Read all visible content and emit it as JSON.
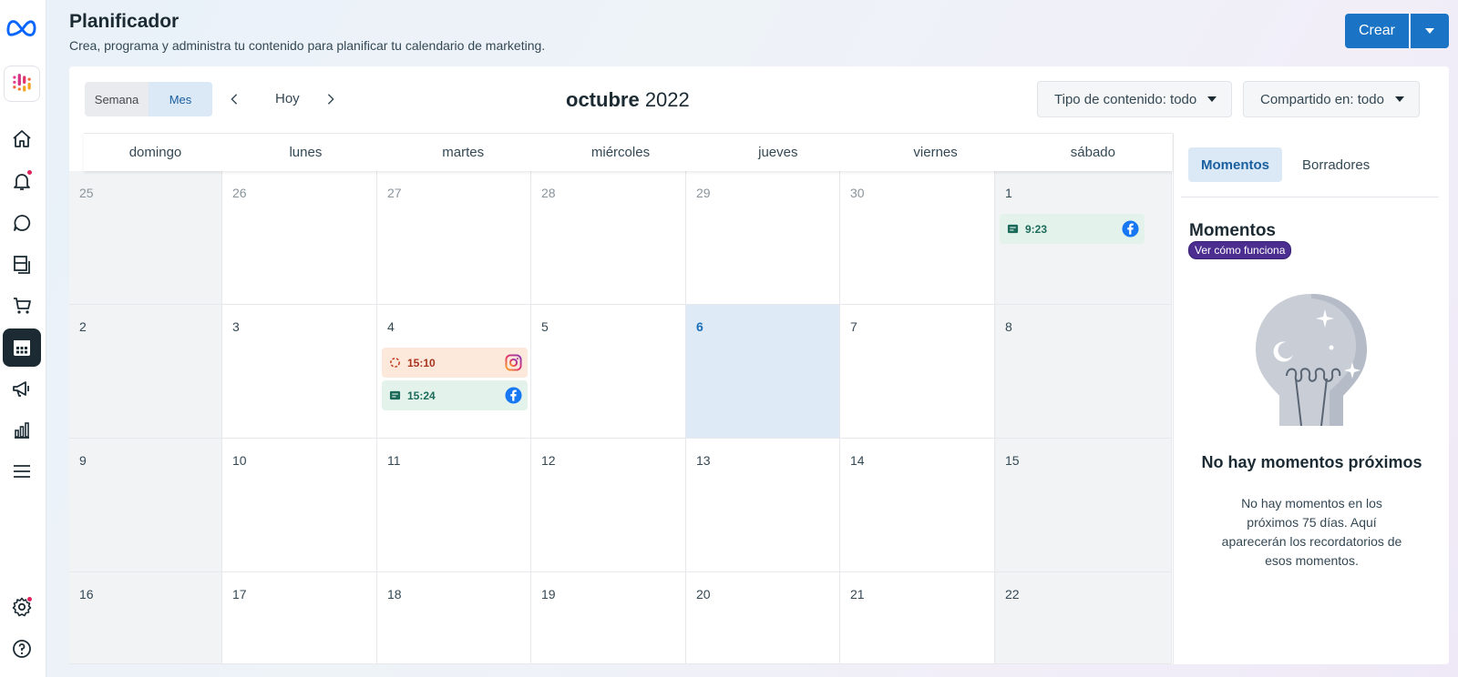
{
  "header": {
    "title": "Planificador",
    "subtitle": "Crea, programa y administra tu contenido para planificar tu calendario de marketing.",
    "create_label": "Crear"
  },
  "toolbar": {
    "view_week": "Semana",
    "view_month": "Mes",
    "today_label": "Hoy",
    "month_name": "octubre",
    "year": "2022",
    "filter_content": "Tipo de contenido: todo",
    "filter_shared": "Compartido en: todo"
  },
  "calendar": {
    "weekdays": [
      "domingo",
      "lunes",
      "martes",
      "miércoles",
      "jueves",
      "viernes",
      "sábado"
    ],
    "weeks": [
      [
        "25",
        "26",
        "27",
        "28",
        "29",
        "30",
        "1"
      ],
      [
        "2",
        "3",
        "4",
        "5",
        "6",
        "7",
        "8"
      ],
      [
        "9",
        "10",
        "11",
        "12",
        "13",
        "14",
        "15"
      ],
      [
        "16",
        "17",
        "18",
        "19",
        "20",
        "21",
        "22"
      ]
    ],
    "events": [
      {
        "time": "9:23",
        "day": "1",
        "type": "post",
        "platform": "facebook"
      },
      {
        "time": "15:10",
        "day": "4",
        "type": "pending",
        "platform": "instagram"
      },
      {
        "time": "15:24",
        "day": "4",
        "type": "post",
        "platform": "facebook"
      }
    ]
  },
  "side": {
    "tab_moments": "Momentos",
    "tab_drafts": "Borradores",
    "moments_title": "Momentos",
    "how_it_works": "Ver cómo funciona",
    "empty_title": "No hay momentos próximos",
    "empty_text": "No hay momentos en los próximos 75 días. Aquí aparecerán los recordatorios de esos momentos."
  },
  "colors": {
    "primary": "#1a73c4",
    "active_tab_bg": "#dbe8f5",
    "today_bg": "#deeaf6",
    "post_event_bg": "#e3f3ec",
    "pending_event_bg": "#fde8dc",
    "link_badge": "#4b2e8f"
  }
}
